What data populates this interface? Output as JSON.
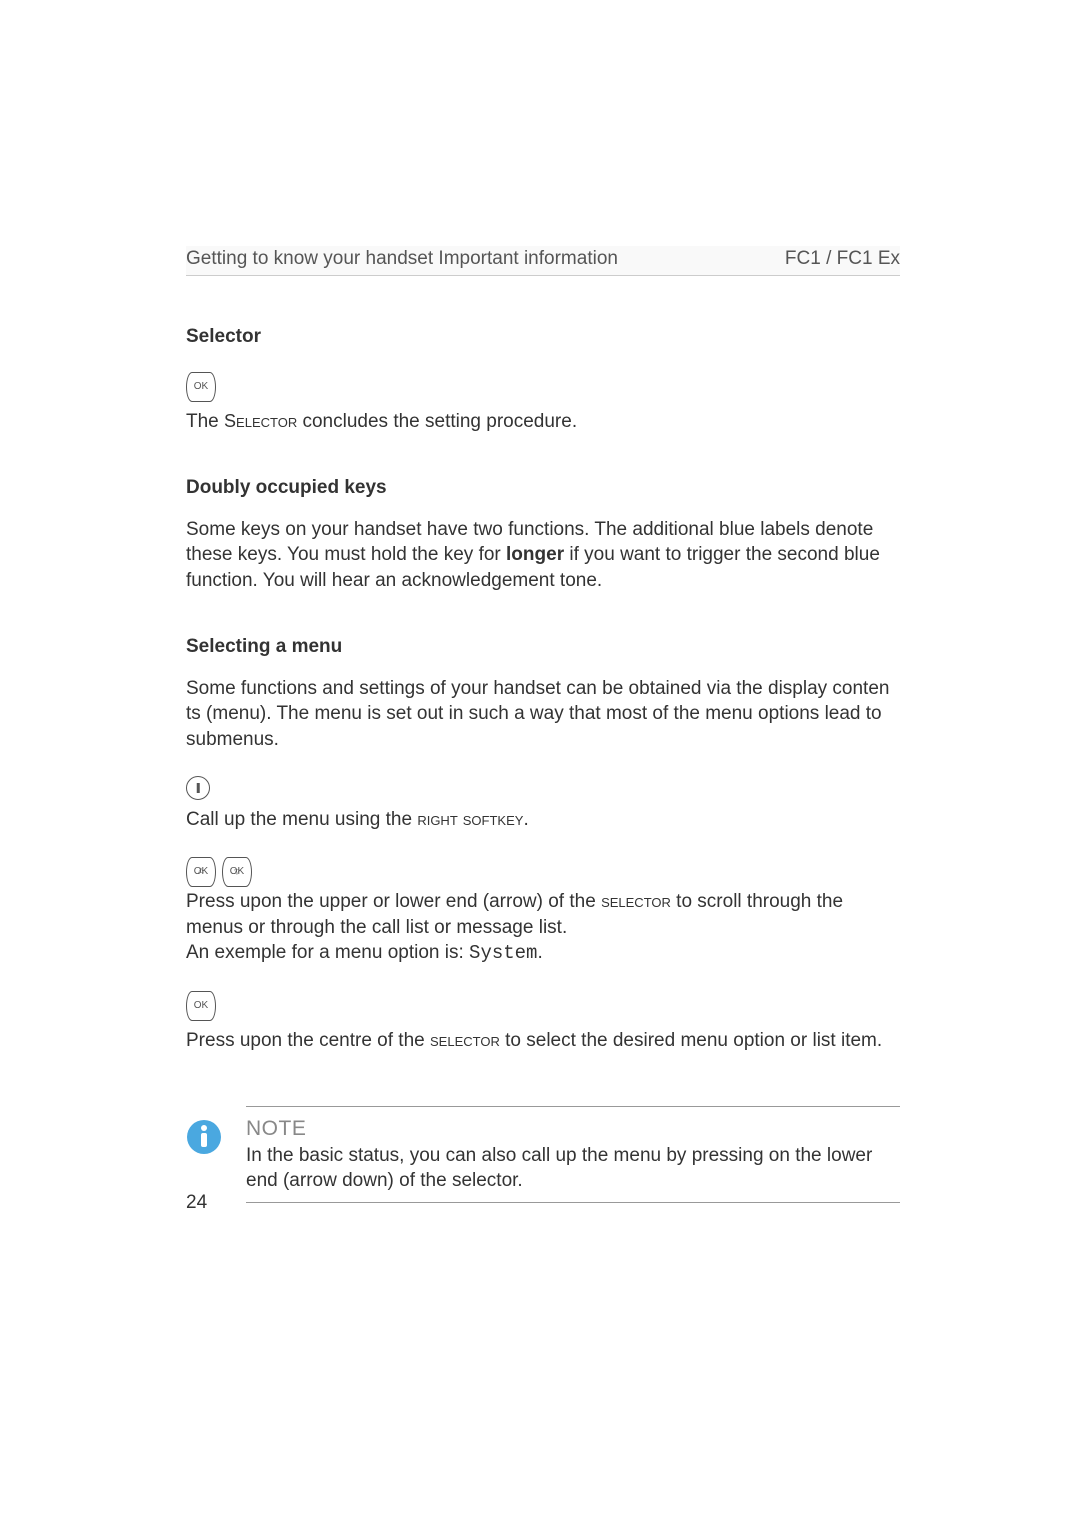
{
  "header": {
    "left": "Getting to know your handset Important information",
    "right": "FC1 / FC1 Ex"
  },
  "sections": {
    "selector": {
      "heading": "Selector",
      "line_pre": "The ",
      "selector_word": "Selector",
      "line_post": " concludes the setting procedure."
    },
    "doubly": {
      "heading": "Doubly occupied keys",
      "para_pre": "Some keys on your handset have two functions. The additional blue labels denote these keys. You must hold the key for ",
      "para_bold": "longer",
      "para_post": " if you want to trigger the second blue function. You will hear an acknowledgement tone."
    },
    "selecting": {
      "heading": "Selecting a menu",
      "intro": "Some functions and settings of your handset can be obtained via the display conten ts (menu). The menu is set out in such a way that most of the menu options lead to submenus.",
      "callup_pre": "Call up the menu using the ",
      "right_softkey": "right softkey",
      "callup_post": ".",
      "scroll_pre": "Press upon the upper or lower end (arrow) of the ",
      "selector_sc": "selector",
      "scroll_post": " to scroll through the menus or through the call list or message list.",
      "example_pre": "An exemple for a menu option is: ",
      "example_mono": "System",
      "example_post": ".",
      "center_pre": "Press upon the centre of the ",
      "center_post": " to select the desired menu option or list item."
    }
  },
  "note": {
    "label": "NOTE",
    "body": "In the basic status, you can also call up the menu by pressing on the lower end (arrow down) of the selector."
  },
  "icons": {
    "ok_label": "OK"
  },
  "page_number": "24"
}
